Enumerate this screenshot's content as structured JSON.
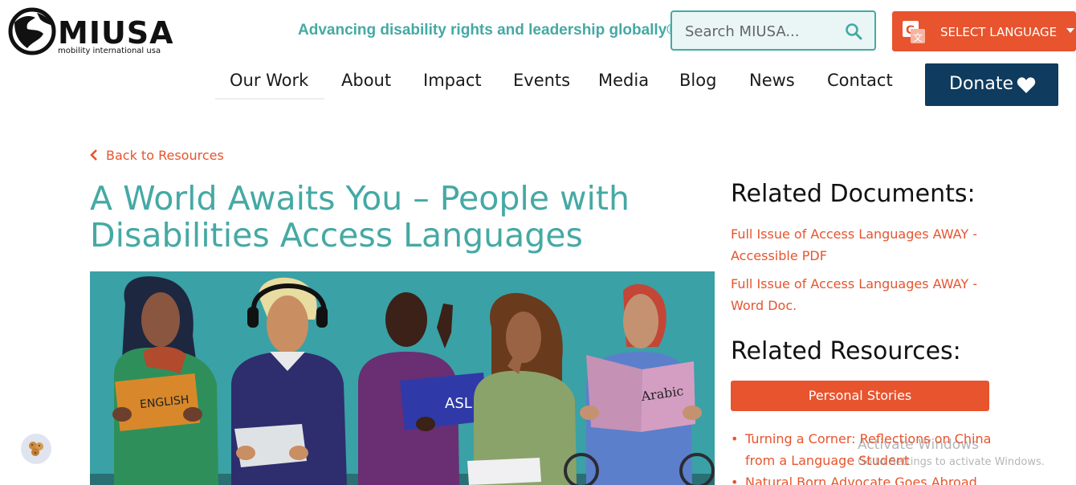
{
  "header": {
    "logo_text": "MIUSA",
    "logo_subtitle": "mobility international usa",
    "tagline": "Advancing disability rights and leadership globally®",
    "search_placeholder": "Search MIUSA...",
    "language_label": "SELECT LANGUAGE"
  },
  "nav": {
    "items": [
      {
        "label": "Our Work"
      },
      {
        "label": "About"
      },
      {
        "label": "Impact"
      },
      {
        "label": "Events"
      },
      {
        "label": "Media"
      },
      {
        "label": "Blog"
      },
      {
        "label": "News"
      },
      {
        "label": "Contact"
      }
    ],
    "donate_label": "Donate"
  },
  "main": {
    "back_label": "Back to Resources",
    "title": "A World Awaits You – People with Disabilities Access Languages",
    "hero": {
      "sign_english": "ENGLISH",
      "book_asl": "ASL",
      "book_arabic": "Arabic"
    }
  },
  "sidebar": {
    "related_documents_heading": "Related Documents:",
    "documents": [
      {
        "label": "Full Issue of Access Languages AWAY - Accessible PDF"
      },
      {
        "label": "Full Issue of Access Languages AWAY - Word Doc."
      }
    ],
    "related_resources_heading": "Related Resources:",
    "category_button": "Personal Stories",
    "resources": [
      {
        "label": "Turning a Corner: Reflections on China from a Language Student"
      },
      {
        "label": "Natural Born Advocate Goes Abroad"
      }
    ]
  },
  "overlay": {
    "activate_title": "Activate Windows",
    "activate_sub": "Go to Settings to activate Windows."
  },
  "colors": {
    "teal": "#45a9a4",
    "orange": "#e7542e",
    "navy": "#0e3b5e"
  },
  "icons": {
    "search": "search-icon",
    "translate": "translate-icon",
    "heart": "heart-icon",
    "back": "chevron-left-icon",
    "cookie": "cookie-icon"
  }
}
